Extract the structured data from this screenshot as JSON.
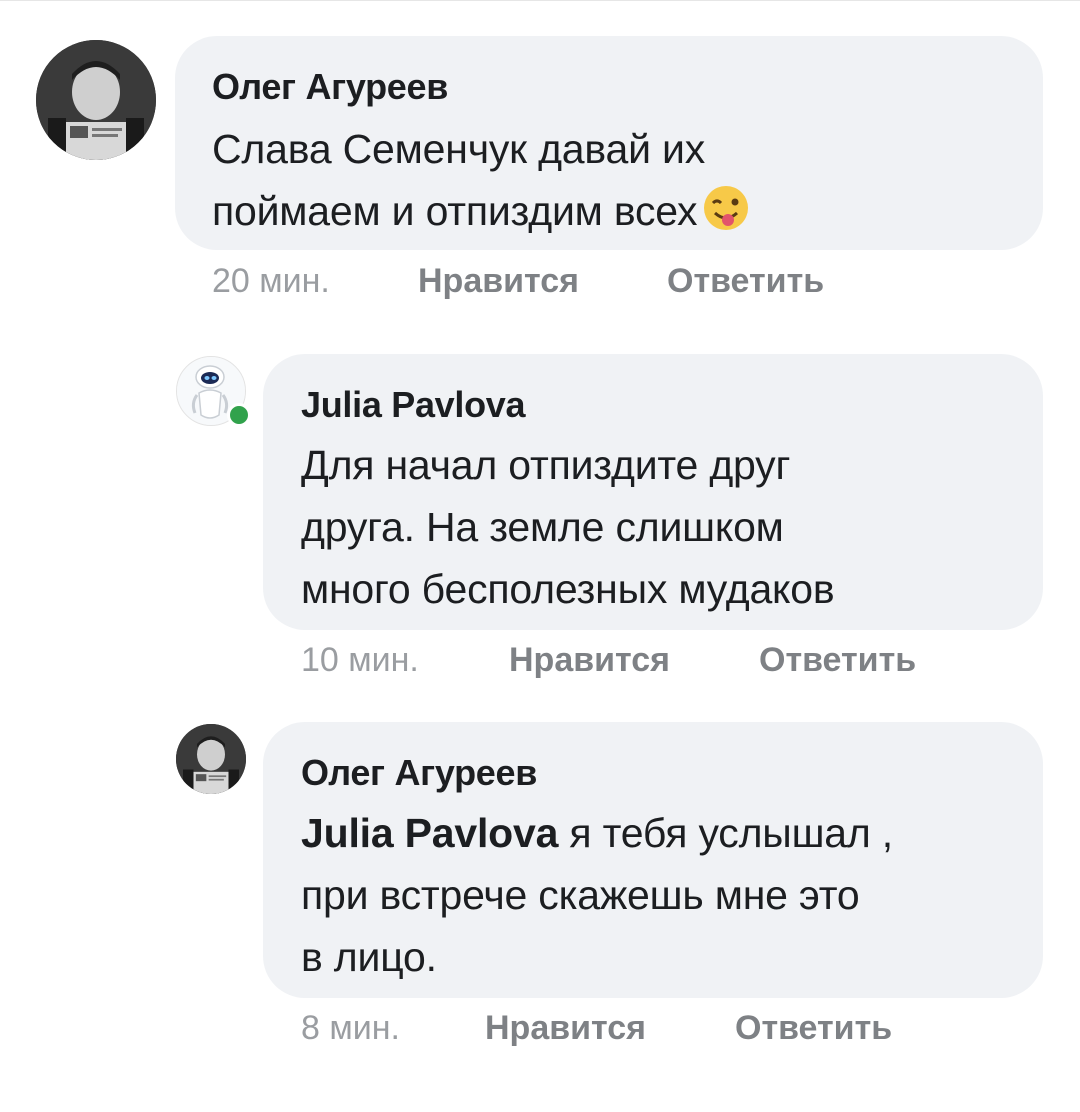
{
  "comments": [
    {
      "author": "Олег Агуреев",
      "lines": [
        "Слава Семенчук давай их",
        "поймаем и отпиздим всех"
      ],
      "emoji": "winking-face-with-tongue",
      "time": "20 мин.",
      "like_label": "Нравится",
      "reply_label": "Ответить"
    },
    {
      "author": "Julia Pavlova",
      "online": true,
      "lines": [
        "Для начал отпиздите друг",
        "друга. На земле слишком",
        "много бесполезных мудаков"
      ],
      "time": "10 мин.",
      "like_label": "Нравится",
      "reply_label": "Ответить"
    },
    {
      "author": "Олег Агуреев",
      "mention": "Julia Pavlova",
      "lines": [
        "я тебя услышал ,",
        "при встрече скажешь мне это",
        "в лицо."
      ],
      "time": "8 мин.",
      "like_label": "Нравится",
      "reply_label": "Ответить"
    }
  ],
  "colors": {
    "bubble": "#f0f2f5",
    "meta_text": "#8a8d91",
    "online": "#31a24c"
  }
}
